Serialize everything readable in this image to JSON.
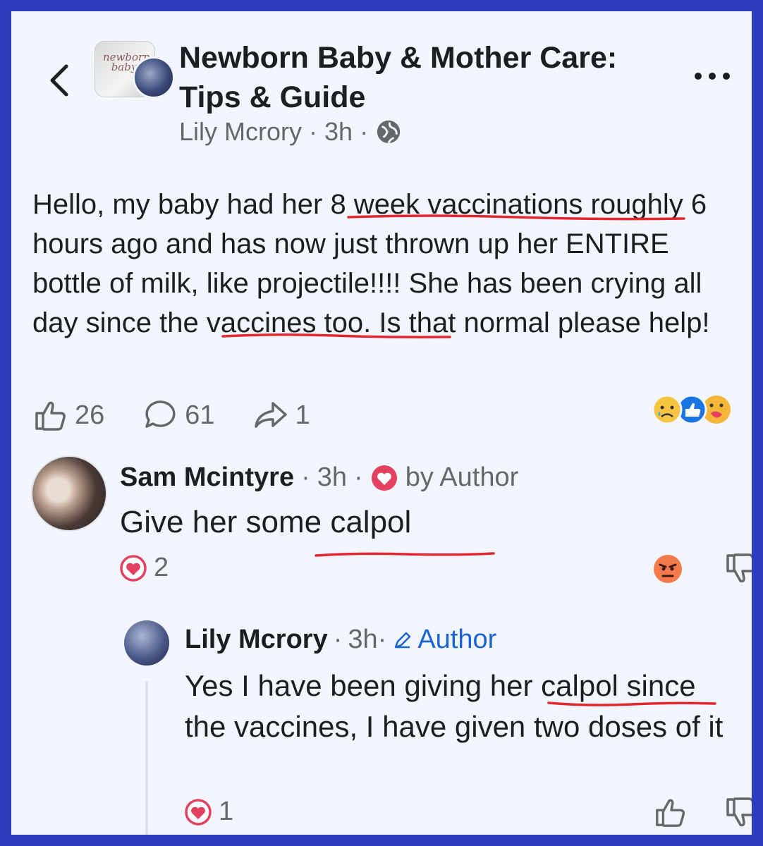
{
  "header": {
    "group_title": "Newborn Baby & Mother Care: Tips & Guide",
    "group_logo_text": "newborn baby",
    "author": "Lily Mcrory",
    "separator": "·",
    "time": "3h",
    "back_icon": "chevron-left-icon",
    "menu_icon": "more-horizontal-icon",
    "privacy_icon": "globe-icon"
  },
  "post": {
    "text": "Hello, my baby had her 8 week vaccinations roughly 6 hours ago and has now just thrown up her ENTIRE bottle of milk, like projectile!!!! She has been crying all day since the vaccines too. Is that normal please help!",
    "likes": "26",
    "comments": "61",
    "shares": "1",
    "reaction_icons": [
      "sad-icon",
      "like-icon",
      "care-icon"
    ]
  },
  "comment": {
    "author": "Sam Mcintyre",
    "time": "3h",
    "badge": "by Author",
    "text": "Give her some calpol",
    "love_count": "2",
    "reaction_icon": "angry-icon"
  },
  "reply": {
    "author": "Lily Mcrory",
    "time": "3h·",
    "badge": "Author",
    "text": "Yes I have been giving her calpol since the vaccines, I have given two doses of it",
    "love_count": "1"
  },
  "colors": {
    "border": "#2f3bbd",
    "background": "#f2f6fc",
    "underline": "#e0282e",
    "accent": "#1b64d6",
    "heart": "#e4405f"
  }
}
